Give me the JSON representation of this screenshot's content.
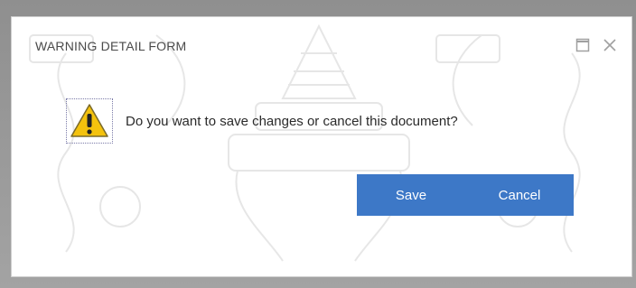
{
  "dialog": {
    "title": "WARNING DETAIL FORM",
    "message": "Do you want to save changes or cancel this document?",
    "icon": "warning-icon",
    "save_label": "Save",
    "cancel_label": "Cancel",
    "controls": {
      "maximize_icon": "maximize-icon",
      "close_icon": "close-icon"
    }
  },
  "colors": {
    "button_bg": "#3d78c7",
    "title_text": "#4a4a4a",
    "warning_yellow": "#f4c20d"
  }
}
